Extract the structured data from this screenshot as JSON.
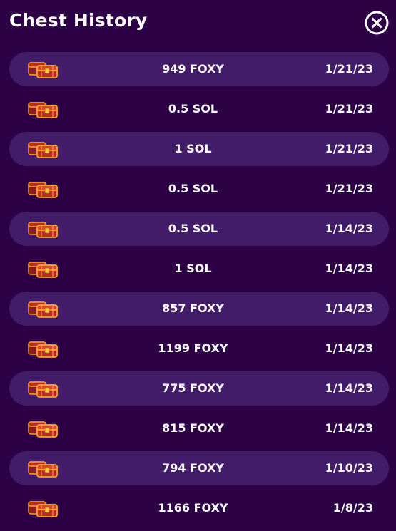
{
  "header": {
    "title": "Chest History",
    "close_icon": "close-circle-icon"
  },
  "colors": {
    "background": "#2d0146",
    "row_shaded": "#421c69",
    "text": "#ffffff",
    "chest_red": "#c0262e",
    "chest_gold": "#f5a623"
  },
  "chest_icon": "treasure-chest-icon",
  "rows": [
    {
      "amount": "949 FOXY",
      "date": "1/21/23"
    },
    {
      "amount": "0.5 SOL",
      "date": "1/21/23"
    },
    {
      "amount": "1 SOL",
      "date": "1/21/23"
    },
    {
      "amount": "0.5 SOL",
      "date": "1/21/23"
    },
    {
      "amount": "0.5 SOL",
      "date": "1/14/23"
    },
    {
      "amount": "1 SOL",
      "date": "1/14/23"
    },
    {
      "amount": "857 FOXY",
      "date": "1/14/23"
    },
    {
      "amount": "1199 FOXY",
      "date": "1/14/23"
    },
    {
      "amount": "775 FOXY",
      "date": "1/14/23"
    },
    {
      "amount": "815 FOXY",
      "date": "1/14/23"
    },
    {
      "amount": "794 FOXY",
      "date": "1/10/23"
    },
    {
      "amount": "1166 FOXY",
      "date": "1/8/23"
    }
  ]
}
